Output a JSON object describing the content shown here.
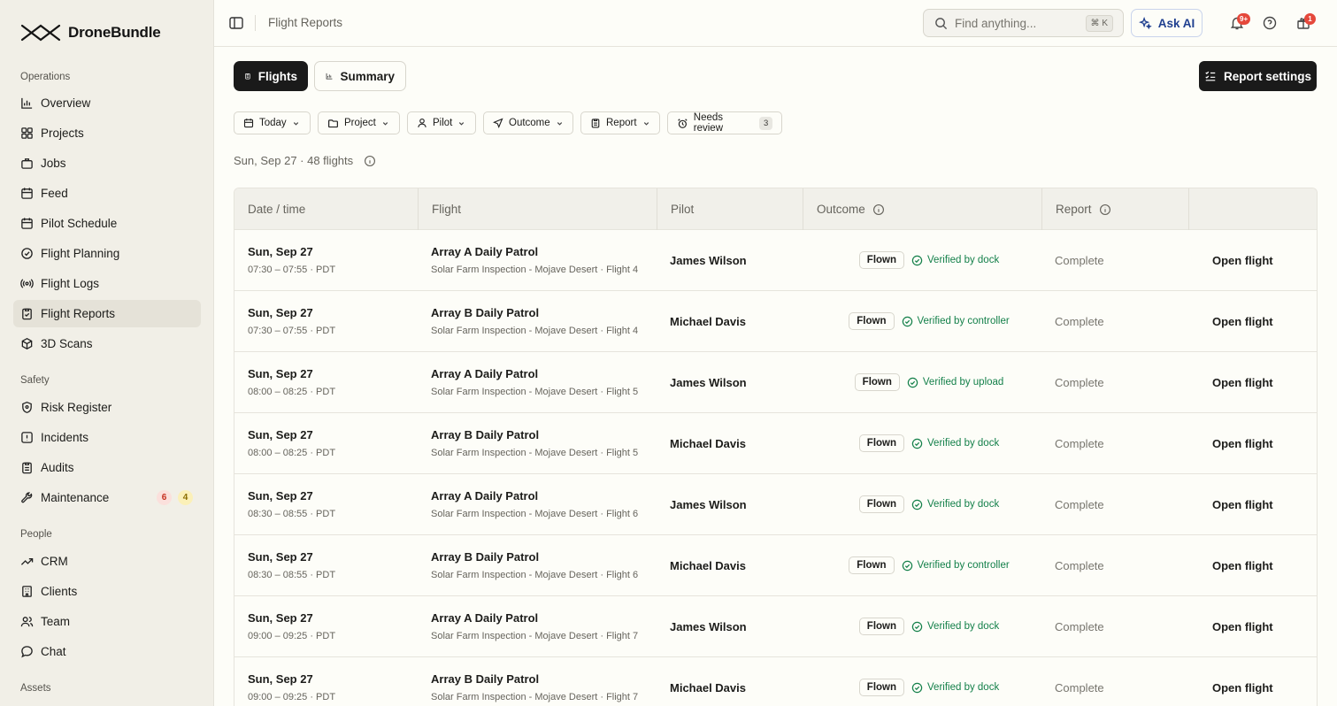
{
  "brand": {
    "name": "DroneBundle"
  },
  "sidebar": {
    "sections": [
      {
        "label": "Operations",
        "items": [
          {
            "label": "Overview",
            "icon": "bar-chart-icon"
          },
          {
            "label": "Projects",
            "icon": "grid-icon"
          },
          {
            "label": "Jobs",
            "icon": "briefcase-icon"
          },
          {
            "label": "Feed",
            "icon": "calendar-icon"
          },
          {
            "label": "Pilot Schedule",
            "icon": "calendar-icon"
          },
          {
            "label": "Flight Planning",
            "icon": "compass-icon"
          },
          {
            "label": "Flight Logs",
            "icon": "radio-icon"
          },
          {
            "label": "Flight Reports",
            "icon": "clipboard-check-icon",
            "active": true
          },
          {
            "label": "3D Scans",
            "icon": "box-icon"
          }
        ]
      },
      {
        "label": "Safety",
        "items": [
          {
            "label": "Risk Register",
            "icon": "shield-icon"
          },
          {
            "label": "Incidents",
            "icon": "alarm-icon"
          },
          {
            "label": "Audits",
            "icon": "clipboard-icon"
          },
          {
            "label": "Maintenance",
            "icon": "wrench-icon",
            "badge_red": "6",
            "badge_yellow": "4"
          }
        ]
      },
      {
        "label": "People",
        "items": [
          {
            "label": "CRM",
            "icon": "trend-icon"
          },
          {
            "label": "Clients",
            "icon": "building-icon"
          },
          {
            "label": "Team",
            "icon": "users-icon"
          },
          {
            "label": "Chat",
            "icon": "chat-icon"
          }
        ]
      },
      {
        "label": "Assets",
        "items": []
      }
    ]
  },
  "topbar": {
    "breadcrumb": "Flight Reports",
    "search_placeholder": "Find anything...",
    "search_shortcut": "⌘ K",
    "ask_ai": "Ask AI",
    "notifications_badge": "9+",
    "gift_badge": "1"
  },
  "toolbar": {
    "tab_flights": "Flights",
    "tab_summary": "Summary",
    "report_settings": "Report settings"
  },
  "filters": {
    "today": "Today",
    "project": "Project",
    "pilot": "Pilot",
    "outcome": "Outcome",
    "report": "Report",
    "needs_review": "Needs review",
    "needs_review_count": "3"
  },
  "summary": "Sun, Sep 27 · 48 flights",
  "table": {
    "headers": {
      "date": "Date / time",
      "flight": "Flight",
      "pilot": "Pilot",
      "outcome": "Outcome",
      "report": "Report"
    },
    "rows": [
      {
        "date": "Sun, Sep 27",
        "time": "07:30 – 07:55 · PDT",
        "flight": "Array A Daily Patrol",
        "sub": "Solar Farm Inspection - Mojave Desert · Flight 4",
        "pilot": "James Wilson",
        "outcome": "Flown",
        "verified": "Verified by dock",
        "report": "Complete",
        "action": "Open flight"
      },
      {
        "date": "Sun, Sep 27",
        "time": "07:30 – 07:55 · PDT",
        "flight": "Array B Daily Patrol",
        "sub": "Solar Farm Inspection - Mojave Desert · Flight 4",
        "pilot": "Michael Davis",
        "outcome": "Flown",
        "verified": "Verified by controller",
        "report": "Complete",
        "action": "Open flight"
      },
      {
        "date": "Sun, Sep 27",
        "time": "08:00 – 08:25 · PDT",
        "flight": "Array A Daily Patrol",
        "sub": "Solar Farm Inspection - Mojave Desert · Flight 5",
        "pilot": "James Wilson",
        "outcome": "Flown",
        "verified": "Verified by upload",
        "report": "Complete",
        "action": "Open flight"
      },
      {
        "date": "Sun, Sep 27",
        "time": "08:00 – 08:25 · PDT",
        "flight": "Array B Daily Patrol",
        "sub": "Solar Farm Inspection - Mojave Desert · Flight 5",
        "pilot": "Michael Davis",
        "outcome": "Flown",
        "verified": "Verified by dock",
        "report": "Complete",
        "action": "Open flight"
      },
      {
        "date": "Sun, Sep 27",
        "time": "08:30 – 08:55 · PDT",
        "flight": "Array A Daily Patrol",
        "sub": "Solar Farm Inspection - Mojave Desert · Flight 6",
        "pilot": "James Wilson",
        "outcome": "Flown",
        "verified": "Verified by dock",
        "report": "Complete",
        "action": "Open flight"
      },
      {
        "date": "Sun, Sep 27",
        "time": "08:30 – 08:55 · PDT",
        "flight": "Array B Daily Patrol",
        "sub": "Solar Farm Inspection - Mojave Desert · Flight 6",
        "pilot": "Michael Davis",
        "outcome": "Flown",
        "verified": "Verified by controller",
        "report": "Complete",
        "action": "Open flight"
      },
      {
        "date": "Sun, Sep 27",
        "time": "09:00 – 09:25 · PDT",
        "flight": "Array A Daily Patrol",
        "sub": "Solar Farm Inspection - Mojave Desert · Flight 7",
        "pilot": "James Wilson",
        "outcome": "Flown",
        "verified": "Verified by dock",
        "report": "Complete",
        "action": "Open flight"
      },
      {
        "date": "Sun, Sep 27",
        "time": "09:00 – 09:25 · PDT",
        "flight": "Array B Daily Patrol",
        "sub": "Solar Farm Inspection - Mojave Desert · Flight 7",
        "pilot": "Michael Davis",
        "outcome": "Flown",
        "verified": "Verified by dock",
        "report": "Complete",
        "action": "Open flight"
      }
    ]
  }
}
